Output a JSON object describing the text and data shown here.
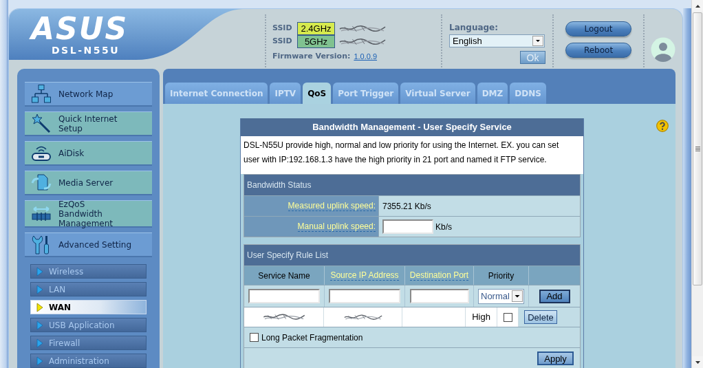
{
  "header": {
    "logo": "ASUS",
    "model": "DSL-N55U",
    "ssids": [
      {
        "label": "SSID",
        "band": "2.4GHz",
        "color": "#d6ea4e"
      },
      {
        "label": "SSID",
        "band": "5GHz",
        "color": "#80c290"
      }
    ],
    "firmware": {
      "label": "Firmware Version:",
      "version": "1.0.0.9"
    },
    "language": {
      "label": "Language:",
      "value": "English",
      "button": {
        "label": "Ok",
        "disabled": true
      }
    },
    "buttons": [
      "Logout",
      "Reboot"
    ]
  },
  "sidebar": {
    "items": [
      {
        "label": "Network Map",
        "color": "#6c9cd3"
      },
      {
        "label": "Quick Internet\nSetup",
        "color": "#7db9bb"
      },
      {
        "label": "AiDisk",
        "color": "#7db9bb"
      },
      {
        "label": "Media Server",
        "color": "#7db9bb"
      },
      {
        "label": "EzQoS\nBandwidth\nManagement",
        "color": "#7db9bb"
      },
      {
        "label": "Advanced Setting",
        "color": "#6c9cd3"
      }
    ],
    "subitems": [
      {
        "label": "Wireless",
        "selected": false
      },
      {
        "label": "LAN",
        "selected": false
      },
      {
        "label": "WAN",
        "selected": true
      },
      {
        "label": "USB Application",
        "selected": false
      },
      {
        "label": "Firewall",
        "selected": false
      },
      {
        "label": "Administration",
        "selected": false
      }
    ]
  },
  "tabs": [
    {
      "label": "Internet Connection",
      "selected": false
    },
    {
      "label": "IPTV",
      "selected": false
    },
    {
      "label": "QoS",
      "selected": true
    },
    {
      "label": "Port Trigger",
      "selected": false
    },
    {
      "label": "Virtual Server",
      "selected": false
    },
    {
      "label": "DMZ",
      "selected": false
    },
    {
      "label": "DDNS",
      "selected": false
    }
  ],
  "panel": {
    "title": "Bandwidth Management - User Specify Service",
    "description": "DSL-N55U provide high, normal and low priority for using the Internet. EX. you can set user with IP:192.168.1.3 have the high priority in 21 port and named it FTP service.",
    "bandwidth_status": {
      "title": "Bandwidth Status",
      "rows": [
        {
          "kind": "text",
          "label": "Measured uplink speed:",
          "value": "7355.21 Kb/s"
        },
        {
          "kind": "input",
          "label": "Manual uplink speed:",
          "unit": "Kb/s"
        }
      ]
    },
    "rule_list": {
      "title": "User Specify Rule List",
      "columns": [
        {
          "label": "Service Name",
          "hint": false
        },
        {
          "label": "Source IP Address",
          "hint": true
        },
        {
          "label": "Destination Port",
          "hint": true
        },
        {
          "label": "Priority",
          "hint": false
        }
      ],
      "new_rule": {
        "priority": "Normal",
        "button": "Add"
      },
      "rows": [
        {
          "priority": "High",
          "checked": false,
          "button": "Delete"
        }
      ]
    },
    "long_packet_fragmentation": {
      "label": "Long Packet Fragmentation",
      "checked": false
    },
    "apply": "Apply"
  }
}
